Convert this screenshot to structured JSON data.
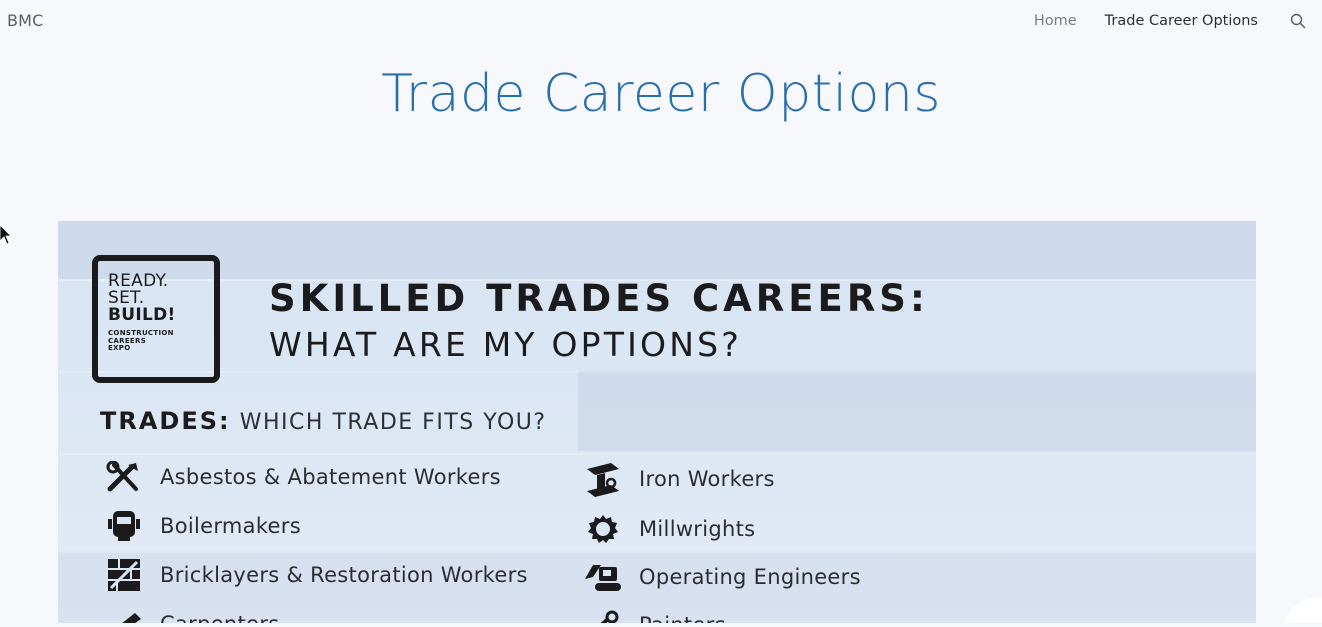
{
  "site": {
    "brand": "BMC"
  },
  "nav": {
    "items": [
      {
        "label": "Home"
      },
      {
        "label": "Trade Career Options"
      }
    ],
    "search_icon": "search-icon"
  },
  "page": {
    "title": "Trade Career Options"
  },
  "banner": {
    "logo": {
      "line1": "READY.",
      "line2": "SET.",
      "line3": "BUILD!",
      "small1": "CONSTRUCTION",
      "small2": "CAREERS",
      "small3": "EXPO"
    },
    "headline1": "SKILLED TRADES CAREERS:",
    "headline2": "WHAT ARE MY OPTIONS?",
    "trades_label_bold": "TRADES:",
    "trades_label_light": "WHICH TRADE FITS YOU?",
    "left_trades": [
      {
        "label": "Asbestos & Abatement Workers",
        "icon": "tools-icon"
      },
      {
        "label": "Boilermakers",
        "icon": "welder-mask-icon"
      },
      {
        "label": "Bricklayers & Restoration Workers",
        "icon": "brick-wall-icon"
      },
      {
        "label": "Carpenters",
        "icon": "saw-icon"
      }
    ],
    "right_trades": [
      {
        "label": "Iron Workers",
        "icon": "steel-beam-icon"
      },
      {
        "label": "Millwrights",
        "icon": "gear-icon"
      },
      {
        "label": "Operating Engineers",
        "icon": "excavator-icon"
      },
      {
        "label": "Painters",
        "icon": "paint-roller-icon"
      }
    ]
  },
  "colors": {
    "title": "#2a6fad",
    "nav_active": "#2b2f36",
    "nav_inactive": "#7a7d83",
    "banner_bg": "#d9e4f3",
    "ink": "#1b1b1d"
  }
}
